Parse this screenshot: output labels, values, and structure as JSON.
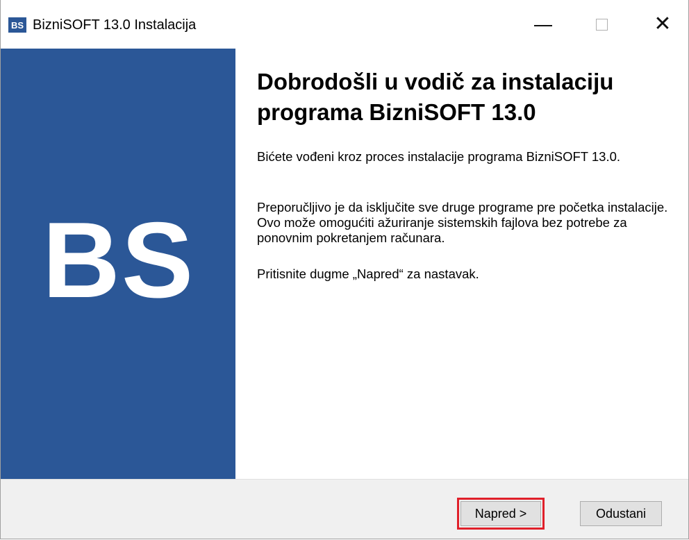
{
  "window": {
    "app_icon_text": "BS",
    "title": "BizniSOFT 13.0 Instalacija"
  },
  "sidebar": {
    "logo_text": "BS",
    "color": "#2b5797"
  },
  "content": {
    "heading": "Dobrodošli u vodič za instalaciju programa BizniSOFT 13.0",
    "paragraph1": "Bićete vođeni kroz proces instalacije programa BizniSOFT 13.0.",
    "paragraph2": "Preporučljivo je da isključite sve druge programe pre početka instalacije. Ovo može omogućiti ažuriranje sistemskih fajlova bez potrebe za ponovnim pokretanjem računara.",
    "paragraph3": "Pritisnite dugme „Napred“ za nastavak."
  },
  "footer": {
    "next_label": "Napred >",
    "cancel_label": "Odustani",
    "highlight_color": "#e0202a"
  },
  "icons": {
    "minimize": "minimize-icon",
    "maximize": "maximize-icon",
    "close": "close-icon"
  }
}
